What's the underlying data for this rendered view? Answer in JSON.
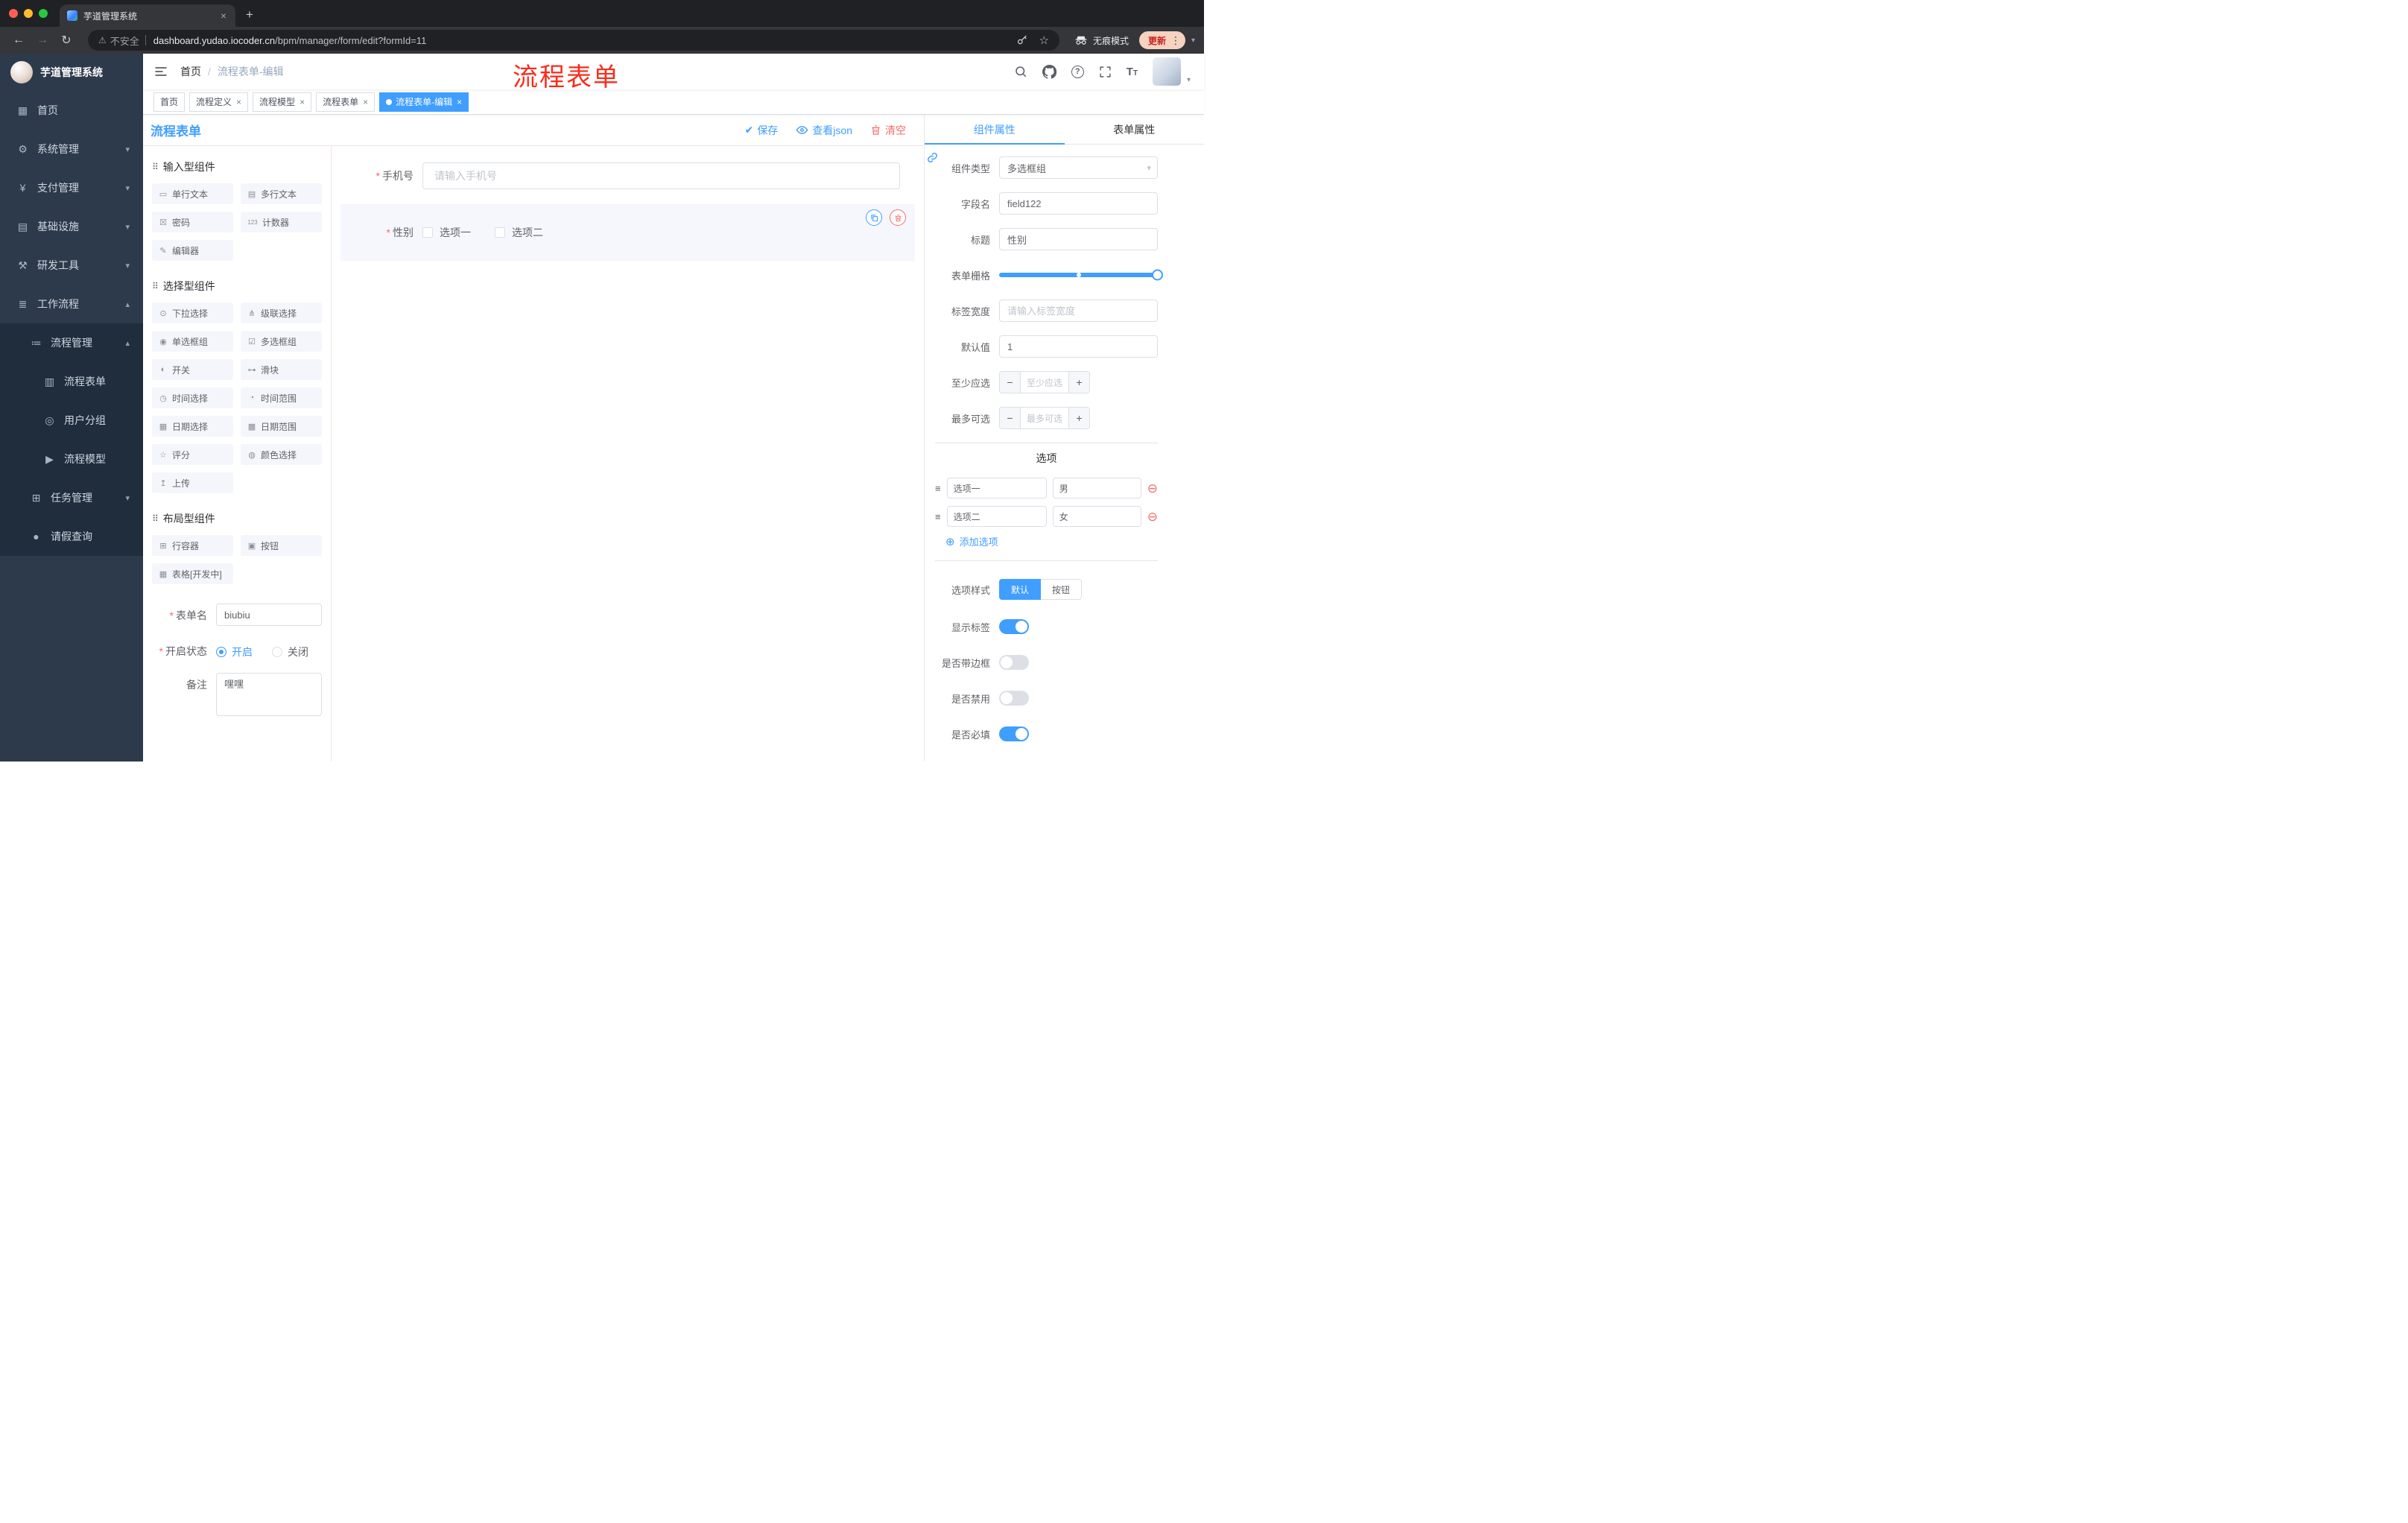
{
  "browser": {
    "tab_title": "芋道管理系统",
    "security_label": "不安全",
    "url_domain": "dashboard.yudao.iocoder.cn",
    "url_path": "/bpm/manager/form/edit?formId=11",
    "incognito_label": "无痕模式",
    "update_label": "更新"
  },
  "sidebar": {
    "logo_title": "芋道管理系统",
    "items": [
      "首页",
      "系统管理",
      "支付管理",
      "基础设施",
      "研发工具",
      "工作流程",
      "流程管理",
      "流程表单",
      "用户分组",
      "流程模型",
      "任务管理",
      "请假查询"
    ]
  },
  "navbar": {
    "breadcrumb_home": "首页",
    "breadcrumb_current": "流程表单-编辑",
    "annotation": "流程表单"
  },
  "tags": [
    "首页",
    "流程定义",
    "流程模型",
    "流程表单",
    "流程表单-编辑"
  ],
  "designer": {
    "title": "流程表单",
    "save": "保存",
    "view_json": "查看json",
    "clear": "清空"
  },
  "components": {
    "group1_title": "输入型组件",
    "group1": [
      "单行文本",
      "多行文本",
      "密码",
      "计数器",
      "编辑器"
    ],
    "group2_title": "选择型组件",
    "group2": [
      "下拉选择",
      "级联选择",
      "单选框组",
      "多选框组",
      "开关",
      "滑块",
      "时间选择",
      "时间范围",
      "日期选择",
      "日期范围",
      "评分",
      "颜色选择",
      "上传"
    ],
    "group3_title": "布局型组件",
    "group3": [
      "行容器",
      "按钮",
      "表格[开发中]"
    ]
  },
  "panel_form": {
    "name_label": "表单名",
    "name_value": "biubiu",
    "status_label": "开启状态",
    "status_on": "开启",
    "status_off": "关闭",
    "remark_label": "备注",
    "remark_value": "嘿嘿"
  },
  "canvas": {
    "phone_label": "手机号",
    "phone_placeholder": "请输入手机号",
    "gender_label": "性别",
    "option1": "选项一",
    "option2": "选项二"
  },
  "props": {
    "tab_component": "组件属性",
    "tab_form": "表单属性",
    "type_label": "组件类型",
    "type_value": "多选框组",
    "field_label": "字段名",
    "field_value": "field122",
    "title_label": "标题",
    "title_value": "性别",
    "grid_label": "表单栅格",
    "width_label": "标签宽度",
    "width_placeholder": "请输入标签宽度",
    "default_label": "默认值",
    "default_value": "1",
    "min_label": "至少应选",
    "min_placeholder": "至少应选",
    "max_label": "最多可选",
    "max_placeholder": "最多可选",
    "options_title": "选项",
    "opt1_label": "选项一",
    "opt1_value": "男",
    "opt2_label": "选项二",
    "opt2_value": "女",
    "add_option": "添加选项",
    "style_label": "选项样式",
    "style_default": "默认",
    "style_button": "按钮",
    "toggle1": "显示标签",
    "toggle2": "是否带边框",
    "toggle3": "是否禁用",
    "toggle4": "是否必填"
  },
  "colors": {
    "accent": "#409eff",
    "danger": "#f56c6c",
    "annotation_red": "#f92c1b",
    "sidebar_bg": "#2d3a4b",
    "submenu_bg": "#1f2d3d"
  }
}
